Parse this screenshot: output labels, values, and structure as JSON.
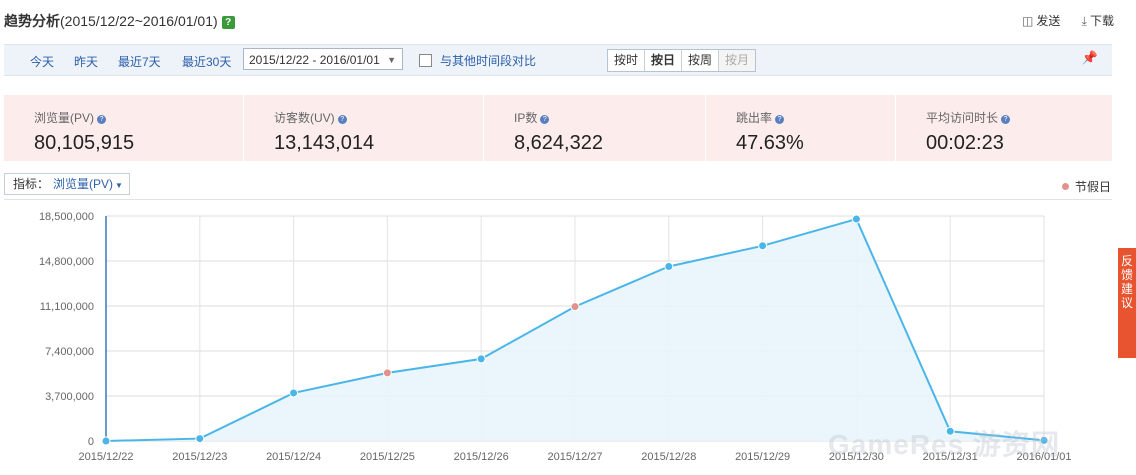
{
  "header": {
    "title": "趋势分析",
    "range": "(2015/12/22~2016/01/01)",
    "help": "?",
    "send_label": "发送",
    "download_label": "下载"
  },
  "toolbar": {
    "quick": [
      "今天",
      "昨天",
      "最近7天",
      "最近30天"
    ],
    "date_range": "2015/12/22 - 2016/01/01",
    "compare_label": "与其他时间段对比",
    "granularity": [
      "按时",
      "按日",
      "按周",
      "按月"
    ],
    "active_granularity": "按日",
    "disabled_granularity": "按月"
  },
  "stats": [
    {
      "label": "浏览量(PV)",
      "value": "80,105,915"
    },
    {
      "label": "访客数(UV)",
      "value": "13,143,014"
    },
    {
      "label": "IP数",
      "value": "8,624,322"
    },
    {
      "label": "跳出率",
      "value": "47.63%"
    },
    {
      "label": "平均访问时长",
      "value": "00:02:23"
    }
  ],
  "metric_selector": {
    "key": "指标：",
    "value": "浏览量(PV)"
  },
  "legend": {
    "holiday": "节假日"
  },
  "feedback_label": [
    "反",
    "馈",
    "建",
    "议"
  ],
  "watermark": "GameRes 游资网",
  "colors": {
    "line": "#4ab5e8",
    "area": "#e8f5fb",
    "holiday": "#e2928c",
    "accent": "#2c5fa8"
  },
  "chart_data": {
    "type": "area",
    "title": "",
    "xlabel": "",
    "ylabel": "",
    "x": [
      "2015/12/22",
      "2015/12/23",
      "2015/12/24",
      "2015/12/25",
      "2015/12/26",
      "2015/12/27",
      "2015/12/28",
      "2015/12/29",
      "2015/12/30",
      "2015/12/31",
      "2016/01/01"
    ],
    "y_ticks": [
      "0",
      "3,700,000",
      "7,400,000",
      "11,100,000",
      "14,800,000",
      "18,500,000"
    ],
    "ylim": [
      0,
      18500000
    ],
    "series": [
      {
        "name": "浏览量(PV)",
        "values": [
          0,
          200000,
          3950000,
          5600000,
          6750000,
          11050000,
          14350000,
          16050000,
          18250000,
          800000,
          50000
        ],
        "holiday": [
          false,
          false,
          false,
          true,
          false,
          true,
          false,
          false,
          false,
          false,
          false
        ]
      }
    ],
    "grid": true
  }
}
